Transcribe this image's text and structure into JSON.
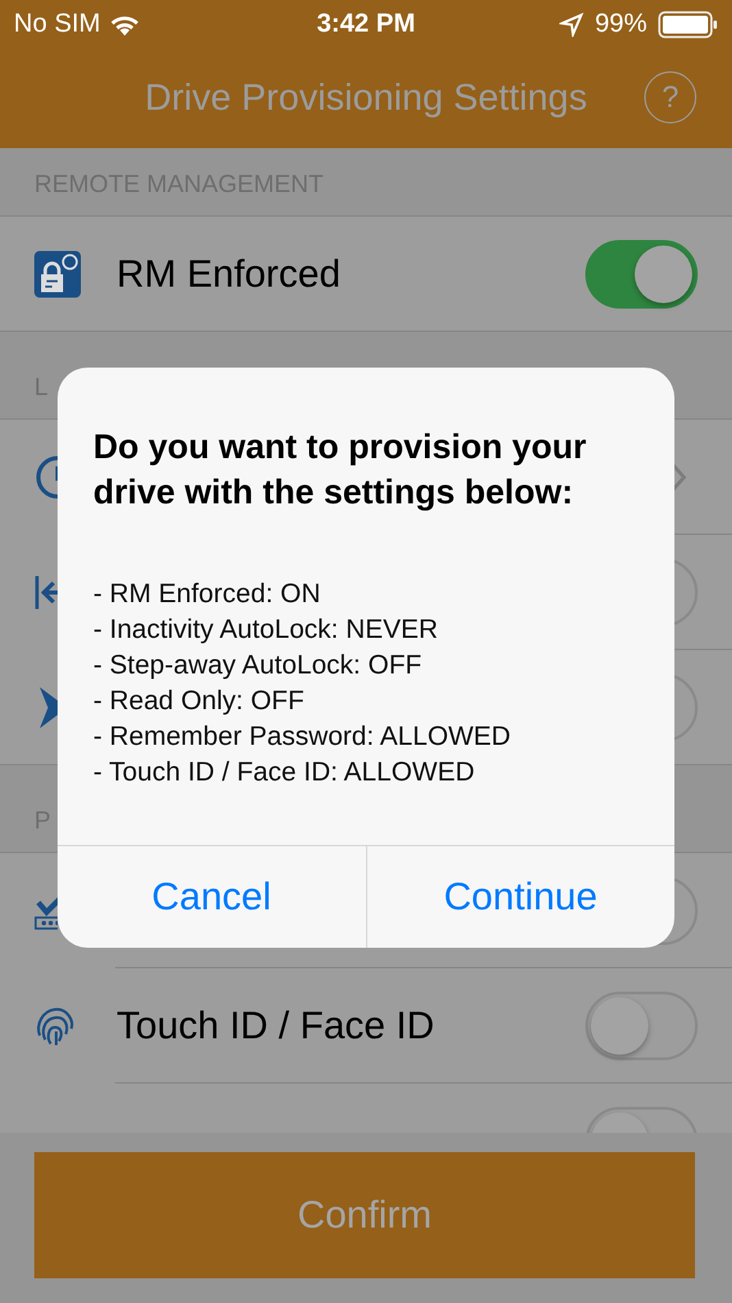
{
  "status_bar": {
    "carrier": "No SIM",
    "time": "3:42 PM",
    "battery": "99%"
  },
  "nav": {
    "title": "Drive Provisioning Settings",
    "help": "?"
  },
  "sections": [
    {
      "header": "REMOTE MANAGEMENT",
      "rows": [
        {
          "label": "RM Enforced",
          "kind": "toggle",
          "on": true
        }
      ]
    },
    {
      "header": "L",
      "rows": [
        {
          "kind": "chevron"
        },
        {
          "kind": "toggle",
          "on": false
        },
        {
          "kind": "toggle",
          "on": false
        }
      ]
    },
    {
      "header": "P",
      "rows": [
        {
          "kind": "toggle",
          "on": false
        },
        {
          "label": "Touch ID / Face ID",
          "kind": "toggle",
          "on": false
        },
        {
          "kind": "toggle",
          "on": false
        }
      ]
    }
  ],
  "confirm": {
    "label": "Confirm"
  },
  "dialog": {
    "title": "Do you want to provision your drive with the settings below:",
    "lines": [
      "- RM Enforced: ON",
      "- Inactivity AutoLock: NEVER",
      "- Step-away AutoLock: OFF",
      "- Read Only: OFF",
      "- Remember Password: ALLOWED",
      "- Touch ID / Face ID: ALLOWED"
    ],
    "buttons": [
      "Cancel",
      "Continue"
    ]
  }
}
